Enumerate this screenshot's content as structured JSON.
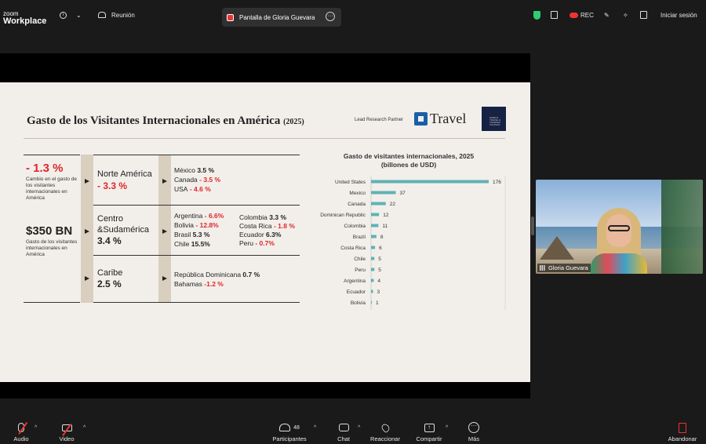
{
  "app": {
    "logo_line1": "zoom",
    "logo_line2": "Workplace",
    "info_icon": "info-icon",
    "meeting_label": "Reunión",
    "share_tab_label": "Pantalla de Gloria Guevara",
    "rec_label": "REC",
    "signin_label": "Iniciar sesión"
  },
  "slide": {
    "title": "Gasto de los Visitantes Internacionales en América",
    "title_year": "(2025)",
    "partner_label": "Lead Research Partner",
    "partner_logo_text": "Travel",
    "wttc_text": "WORLD TRAVEL & TOURISM COUNCIL",
    "left": {
      "change_value": "- 1.3 %",
      "change_desc": "Cambio en el gasto de los visitantes internacionales en América",
      "total_value": "$350 BN",
      "total_desc": "Gasto de los visitantes internacionales en América"
    },
    "regions": [
      {
        "name": "Norte América",
        "value": "- 3.3 %",
        "red": true
      },
      {
        "name": "Centro &Sudamérica",
        "value": "3.4 %",
        "red": false
      },
      {
        "name": "Caribe",
        "value": "2.5 %",
        "red": false
      }
    ],
    "countries": {
      "norte": [
        {
          "name": "México",
          "value": "3.5 %",
          "red": false
        },
        {
          "name": "Canada",
          "value": "- 3.5 %",
          "red": true
        },
        {
          "name": "USA",
          "value": "- 4.6 %",
          "red": true
        }
      ],
      "centro_a": [
        {
          "name": "Argentina",
          "value": "- 6.6%",
          "red": true
        },
        {
          "name": "Bolivia",
          "value": "- 12.8%",
          "red": true
        },
        {
          "name": "Brasil",
          "value": "5.3 %",
          "red": false
        },
        {
          "name": "Chile",
          "value": "15.5%",
          "red": false
        }
      ],
      "centro_b": [
        {
          "name": "Colombia",
          "value": "3.3 %",
          "red": false
        },
        {
          "name": "Costa Rica",
          "value": "- 1.8 %",
          "red": true
        },
        {
          "name": "Ecuador",
          "value": "6.3%",
          "red": false
        },
        {
          "name": "Peru",
          "value": "- 0.7%",
          "red": true
        }
      ],
      "caribe": [
        {
          "name": "República Dominicana",
          "value": "0.7 %",
          "red": false
        },
        {
          "name": "Bahamas",
          "value": "-1.2 %",
          "red": true
        }
      ]
    }
  },
  "chart_data": {
    "type": "bar",
    "orientation": "horizontal",
    "title": "Gasto de visitantes internacionales, 2025",
    "subtitle": "(billones de USD)",
    "categories": [
      "United States",
      "Mexico",
      "Canada",
      "Dominican Republic",
      "Colombia",
      "Brazil",
      "Costa Rica",
      "Chile",
      "Peru",
      "Argentina",
      "Ecuador",
      "Bolivia"
    ],
    "values": [
      176,
      37,
      22,
      12,
      11,
      8,
      6,
      5,
      5,
      4,
      3,
      1
    ],
    "xlim": [
      0,
      176
    ],
    "grid": false,
    "bar_color": "#5fb3b3"
  },
  "participant": {
    "name": "Gloria Guevara"
  },
  "toolbar": {
    "audio": "Audio",
    "video": "Video",
    "participants": "Participantes",
    "participants_count": "48",
    "chat": "Chat",
    "react": "Reaccionar",
    "share": "Compartir",
    "more": "Más",
    "leave": "Abandonar"
  }
}
